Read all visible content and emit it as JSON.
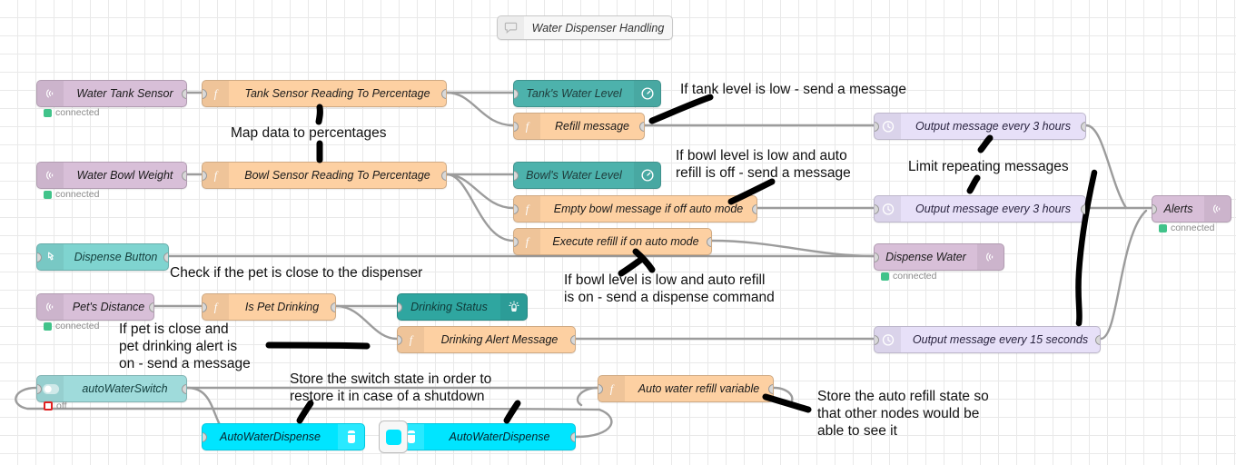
{
  "editor": {
    "tab_title": "Water Dispenser Handling",
    "tab_icon": "comment-icon",
    "background": "#ffffff",
    "grid_color": "#e9e9e9"
  },
  "colors": {
    "mqtt": "#d8bfd8",
    "function": "#fdd0a2",
    "gauge": "#4db2ac",
    "button": "#7fd4d0",
    "led": "#2fa6a0",
    "delay": "#e7e0f8",
    "switch": "#9fdbdb",
    "variable": "#00e5ff",
    "wire": "#999999",
    "status_connected": "#41c38a",
    "status_off": "#e02020",
    "annotation": "#111111"
  },
  "nodes": [
    {
      "id": "water-tank-sensor",
      "label": "Water Tank Sensor",
      "type": "mqtt-in",
      "icon": "signal-icon",
      "status": "connected"
    },
    {
      "id": "tank-to-percentage",
      "label": "Tank Sensor Reading To Percentage",
      "type": "function",
      "icon": "function-icon",
      "status": ""
    },
    {
      "id": "tanks-water-level",
      "label": "Tank's Water Level",
      "type": "gauge",
      "icon": "gauge-icon",
      "status": ""
    },
    {
      "id": "refill-message",
      "label": "Refill message",
      "type": "function",
      "icon": "function-icon",
      "status": ""
    },
    {
      "id": "water-bowl-weight",
      "label": "Water Bowl Weight",
      "type": "mqtt-in",
      "icon": "signal-icon",
      "status": "connected"
    },
    {
      "id": "bowl-to-percentage",
      "label": "Bowl Sensor Reading To Percentage",
      "type": "function",
      "icon": "function-icon",
      "status": ""
    },
    {
      "id": "bowls-water-level",
      "label": "Bowl's Water Level",
      "type": "gauge",
      "icon": "gauge-icon",
      "status": ""
    },
    {
      "id": "empty-bowl-message",
      "label": "Empty bowl message if off auto mode",
      "type": "function",
      "icon": "function-icon",
      "status": ""
    },
    {
      "id": "execute-refill",
      "label": "Execute refill if on auto mode",
      "type": "function",
      "icon": "function-icon",
      "status": ""
    },
    {
      "id": "dispense-button",
      "label": "Dispense Button",
      "type": "button",
      "icon": "click-icon",
      "status": ""
    },
    {
      "id": "pets-distance",
      "label": "Pet's Distance",
      "type": "mqtt-in",
      "icon": "signal-icon",
      "status": "connected"
    },
    {
      "id": "is-pet-drinking",
      "label": "Is Pet Drinking",
      "type": "function",
      "icon": "function-icon",
      "status": ""
    },
    {
      "id": "drinking-status",
      "label": "Drinking Status",
      "type": "led",
      "icon": "led-icon",
      "status": ""
    },
    {
      "id": "drinking-alert-message",
      "label": "Drinking Alert Message",
      "type": "function",
      "icon": "function-icon",
      "status": ""
    },
    {
      "id": "auto-water-switch",
      "label": "autoWaterSwitch",
      "type": "switch",
      "icon": "toggle-icon",
      "status": "off"
    },
    {
      "id": "auto-water-dispense-set",
      "label": "AutoWaterDispense",
      "type": "variable",
      "icon": "variable-icon",
      "status": ""
    },
    {
      "id": "auto-water-dispense-get",
      "label": "AutoWaterDispense",
      "type": "variable",
      "icon": "variable-icon",
      "status": ""
    },
    {
      "id": "auto-water-refill-var",
      "label": "Auto water refill variable",
      "type": "function",
      "icon": "function-icon",
      "status": ""
    },
    {
      "id": "output-every-3-hours-1",
      "label": "Output message every 3 hours",
      "type": "delay",
      "icon": "delay-icon",
      "status": ""
    },
    {
      "id": "output-every-3-hours-2",
      "label": "Output message every 3 hours",
      "type": "delay",
      "icon": "delay-icon",
      "status": ""
    },
    {
      "id": "output-every-15-seconds",
      "label": "Output message every 15 seconds",
      "type": "delay",
      "icon": "delay-icon",
      "status": ""
    },
    {
      "id": "dispense-water",
      "label": "Dispense Water",
      "type": "mqtt-out",
      "icon": "signal-icon",
      "status": "connected"
    },
    {
      "id": "alerts",
      "label": "Alerts",
      "type": "mqtt-out",
      "icon": "signal-icon",
      "status": "connected"
    }
  ],
  "status_labels": {
    "connected": "connected",
    "off": "off"
  },
  "annotations": [
    {
      "id": "map-data",
      "text": "Map data to percentages"
    },
    {
      "id": "tank-low",
      "text": "If tank level is low - send a message"
    },
    {
      "id": "bowl-low-off",
      "text": "If bowl level is low and auto\nrefill is off - send a message"
    },
    {
      "id": "limit-repeating",
      "text": "Limit repeating messages"
    },
    {
      "id": "bowl-low-on",
      "text": "If bowl level is low and auto refill\nis on - send a dispense command"
    },
    {
      "id": "check-pet-close",
      "text": "Check if the pet is close to the dispenser"
    },
    {
      "id": "pet-close-alert",
      "text": "If pet is close and\npet drinking alert is\non - send a message"
    },
    {
      "id": "store-switch",
      "text": "Store the switch state in order to\nrestore it in case of a shutdown"
    },
    {
      "id": "store-refill",
      "text": "Store the auto refill state so\nthat other nodes would be\nable to see it"
    }
  ]
}
